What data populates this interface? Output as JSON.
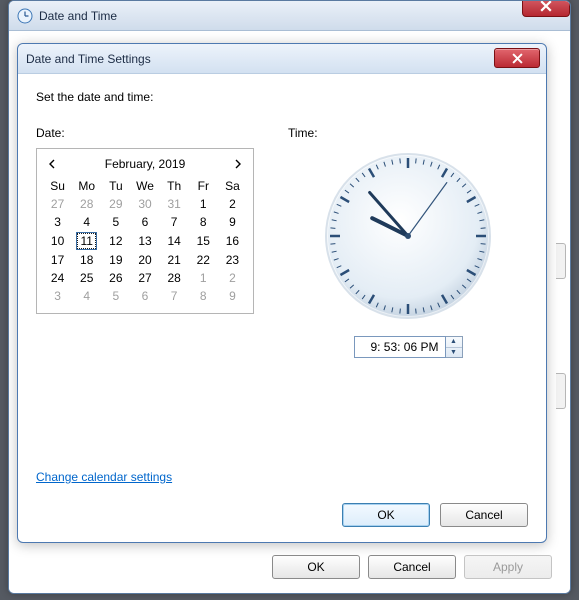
{
  "outer": {
    "title": "Date and Time",
    "buttons": {
      "ok": "OK",
      "cancel": "Cancel",
      "apply": "Apply"
    }
  },
  "dialog": {
    "title": "Date and Time Settings",
    "instruction": "Set the date and time:",
    "date_label": "Date:",
    "time_label": "Time:",
    "link": "Change calendar settings",
    "ok": "OK",
    "cancel": "Cancel"
  },
  "calendar": {
    "title": "February, 2019",
    "dow": [
      "Su",
      "Mo",
      "Tu",
      "We",
      "Th",
      "Fr",
      "Sa"
    ],
    "weeks": [
      [
        {
          "d": "27",
          "o": true
        },
        {
          "d": "28",
          "o": true
        },
        {
          "d": "29",
          "o": true
        },
        {
          "d": "30",
          "o": true
        },
        {
          "d": "31",
          "o": true
        },
        {
          "d": "1"
        },
        {
          "d": "2"
        }
      ],
      [
        {
          "d": "3"
        },
        {
          "d": "4"
        },
        {
          "d": "5"
        },
        {
          "d": "6"
        },
        {
          "d": "7"
        },
        {
          "d": "8"
        },
        {
          "d": "9"
        }
      ],
      [
        {
          "d": "10"
        },
        {
          "d": "11",
          "sel": true
        },
        {
          "d": "12"
        },
        {
          "d": "13"
        },
        {
          "d": "14"
        },
        {
          "d": "15"
        },
        {
          "d": "16"
        }
      ],
      [
        {
          "d": "17"
        },
        {
          "d": "18"
        },
        {
          "d": "19"
        },
        {
          "d": "20"
        },
        {
          "d": "21"
        },
        {
          "d": "22"
        },
        {
          "d": "23"
        }
      ],
      [
        {
          "d": "24"
        },
        {
          "d": "25"
        },
        {
          "d": "26"
        },
        {
          "d": "27"
        },
        {
          "d": "28"
        },
        {
          "d": "1",
          "o": true
        },
        {
          "d": "2",
          "o": true
        }
      ],
      [
        {
          "d": "3",
          "o": true
        },
        {
          "d": "4",
          "o": true
        },
        {
          "d": "5",
          "o": true
        },
        {
          "d": "6",
          "o": true
        },
        {
          "d": "7",
          "o": true
        },
        {
          "d": "8",
          "o": true
        },
        {
          "d": "9",
          "o": true
        }
      ]
    ]
  },
  "time": {
    "value": "9: 53: 06 PM",
    "hour12": 9,
    "minute": 53,
    "second": 6
  }
}
